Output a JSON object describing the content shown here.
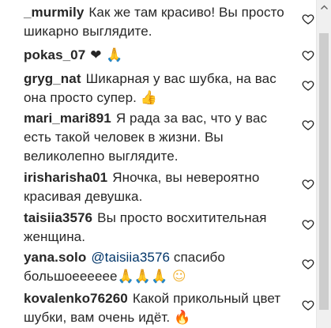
{
  "comments": [
    {
      "username": "_murmily",
      "text": "Как же там красиво! Вы просто шикарно выглядите.",
      "emoji": ""
    },
    {
      "username": "pokas_07",
      "text": "",
      "emoji": "❤ 🙏"
    },
    {
      "username": "gryg_nat",
      "text": "Шикарная у вас шубка, на вас она просто супер.",
      "emoji": "👍"
    },
    {
      "username": "mari_mari891",
      "text": "Я рада за вас, что у вас есть такой человек в жизни. Вы великолепно выглядите.",
      "emoji": ""
    },
    {
      "username": "irisharisha01",
      "text": "Яночка, вы невероятно красивая девушка.",
      "emoji": ""
    },
    {
      "username": "taisiia3576",
      "text": "Вы просто восхитительная женщина.",
      "emoji": ""
    },
    {
      "username": "yana.solo",
      "mention": "@taisiia3576",
      "text": "спасибо большоееееее",
      "emoji": "🙏🙏🙏 ☺"
    },
    {
      "username": "kovalenko76260",
      "text": "Какой прикольный цвет шубки, вам очень идёт.",
      "emoji": "🔥"
    }
  ],
  "icons": {
    "like": "heart-outline-icon",
    "scroll_up": "chevron-up-icon"
  },
  "colors": {
    "text": "#262626",
    "mention": "#003569",
    "icon": "#262626",
    "scrollbar_track": "#f0f0f0",
    "scrollbar_thumb": "#cdcdcd"
  }
}
